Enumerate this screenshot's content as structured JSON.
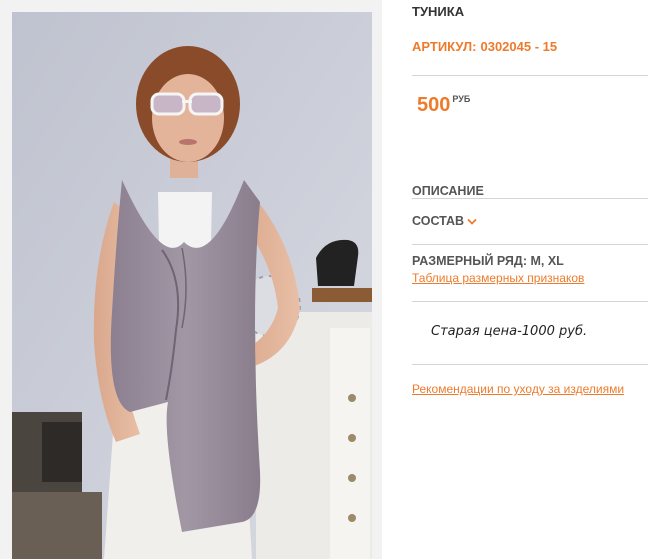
{
  "product": {
    "title": "ТУНИКА",
    "sku_label": "АРТИКУЛ:",
    "sku_value": "0302045 - 15",
    "price_value": "500",
    "price_currency": "РУБ",
    "image_alt": "product-photo"
  },
  "sections": {
    "description_label": "ОПИСАНИЕ",
    "composition_label": "СОСТАВ",
    "size_range_label": "РАЗМЕРНЫЙ РЯД:",
    "size_range_value": "M, XL",
    "size_table_link": "Таблица размерных признаков",
    "old_price": "Старая цена-1000 руб.",
    "care_link": "Рекомендации по уходу за изделиями"
  },
  "colors": {
    "accent": "#ee7b2c",
    "text_dark": "#333333",
    "divider": "#d4d4d4"
  },
  "icons": {
    "composition_toggle": "chevron-down-icon"
  }
}
